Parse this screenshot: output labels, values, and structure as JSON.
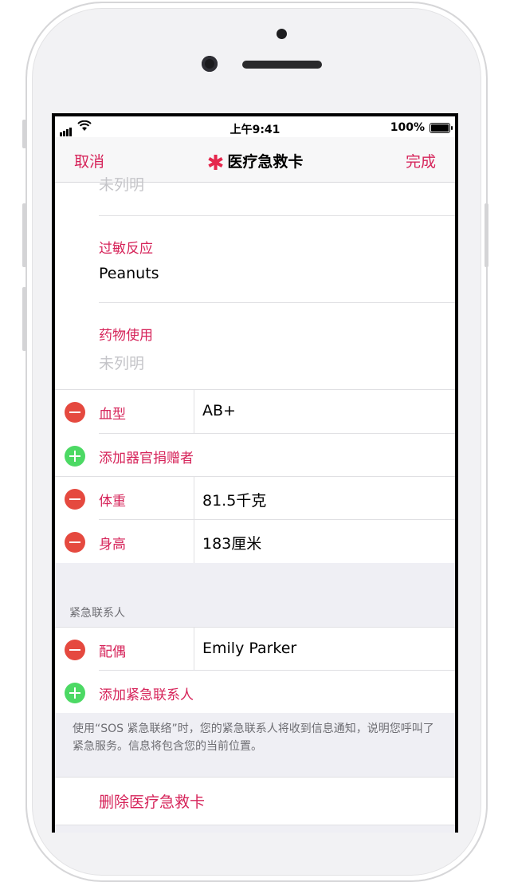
{
  "status_bar": {
    "time": "上午9:41",
    "battery": "100%"
  },
  "navbar": {
    "cancel": "取消",
    "title": "医疗急救卡",
    "title_icon": "star-of-life-icon",
    "done": "完成"
  },
  "fields": {
    "top_partial_value": "未列明",
    "allergies": {
      "label": "过敏反应",
      "value": "Peanuts"
    },
    "medications": {
      "label": "药物使用",
      "value": "未列明"
    }
  },
  "rows": {
    "blood_type": {
      "label": "血型",
      "value": "AB+"
    },
    "add_organ_donor": {
      "label": "添加器官捐赠者"
    },
    "weight": {
      "label": "体重",
      "value": "81.5千克"
    },
    "height": {
      "label": "身高",
      "value": "183厘米"
    }
  },
  "emergency_contacts": {
    "header": "紧急联系人",
    "contact": {
      "label": "配偶",
      "value": "Emily Parker"
    },
    "add_contact": "添加紧急联系人",
    "footnote": "使用“SOS 紧急联络”时，您的紧急联系人将收到信息通知，说明您呼叫了紧急服务。信息将包含您的当前位置。"
  },
  "delete_label": "删除医疗急救卡",
  "colors": {
    "accent": "#d6245a",
    "delete_circle": "#e5493f",
    "add_circle": "#4cd964"
  }
}
